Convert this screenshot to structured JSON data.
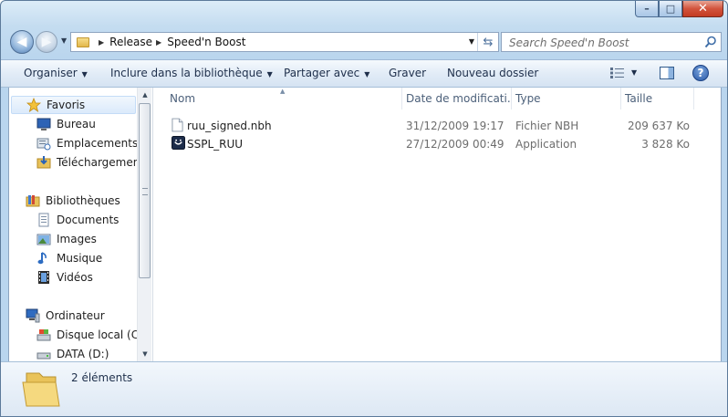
{
  "window": {
    "caption_buttons": {
      "minimize": "–",
      "maximize": "□",
      "close": "✕"
    }
  },
  "navbar": {
    "breadcrumb": [
      "Release",
      "Speed'n Boost"
    ],
    "search_placeholder": "Search Speed'n Boost"
  },
  "toolbar": {
    "organise": "Organiser",
    "include_library": "Inclure dans la bibliothèque",
    "share": "Partager avec",
    "burn": "Graver",
    "new_folder": "Nouveau dossier"
  },
  "sidebar": {
    "favorites": {
      "label": "Favoris",
      "items": [
        {
          "label": "Bureau",
          "icon": "desktop-icon"
        },
        {
          "label": "Emplacements récents",
          "icon": "recent-places-icon"
        },
        {
          "label": "Téléchargements",
          "icon": "downloads-icon"
        }
      ]
    },
    "libraries": {
      "label": "Bibliothèques",
      "items": [
        {
          "label": "Documents",
          "icon": "documents-icon"
        },
        {
          "label": "Images",
          "icon": "pictures-icon"
        },
        {
          "label": "Musique",
          "icon": "music-icon"
        },
        {
          "label": "Vidéos",
          "icon": "videos-icon"
        }
      ]
    },
    "computer": {
      "label": "Ordinateur",
      "items": [
        {
          "label": "Disque local (C:)",
          "icon": "local-disk-icon"
        },
        {
          "label": "DATA (D:)",
          "icon": "drive-icon"
        }
      ]
    }
  },
  "files": {
    "columns": [
      "Nom",
      "Date de modification",
      "Type",
      "Taille"
    ],
    "column_display": [
      "Nom",
      "Date de modificati...",
      "Type",
      "Taille"
    ],
    "rows": [
      {
        "name": "ruu_signed.nbh",
        "date": "31/12/2009 19:17",
        "type": "Fichier NBH",
        "size": "209 637 Ko",
        "icon": "document-file-icon"
      },
      {
        "name": "SSPL_RUU",
        "date": "27/12/2009 00:49",
        "type": "Application",
        "size": "3 828 Ko",
        "icon": "application-icon"
      }
    ]
  },
  "status": {
    "count": "2 éléments"
  },
  "colors": {
    "selection": "#dbeafb",
    "header_text": "#4c607a",
    "meta_text": "#6d6d6d"
  }
}
